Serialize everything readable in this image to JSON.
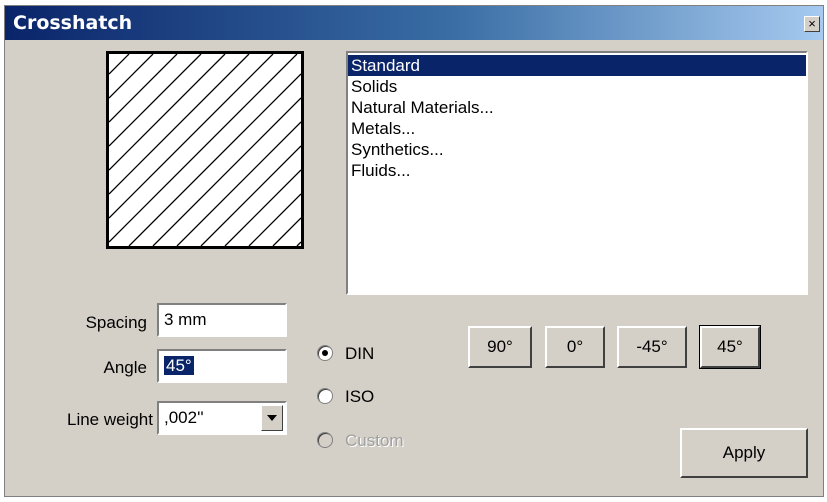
{
  "window": {
    "title": "Crosshatch",
    "close_glyph": "×"
  },
  "pattern_list": {
    "items": [
      "Standard",
      "Solids",
      "Natural Materials...",
      "Metals...",
      "Synthetics...",
      "Fluids..."
    ],
    "selected": "Standard"
  },
  "fields": {
    "spacing_label": "Spacing",
    "spacing_value": "3 mm",
    "angle_label": "Angle",
    "angle_value": "45°",
    "line_weight_label": "Line weight",
    "line_weight_value": ",002''"
  },
  "standards": {
    "din": "DIN",
    "iso": "ISO",
    "custom": "Custom",
    "selected": "DIN"
  },
  "angle_buttons": [
    "90°",
    "0°",
    "-45°",
    "45°"
  ],
  "apply_label": "Apply",
  "colors": {
    "selection": "#0a246a",
    "dialog_face": "#d4d0c8"
  },
  "icons": [
    "close-icon",
    "dropdown-arrow-icon",
    "hatch-preview"
  ]
}
